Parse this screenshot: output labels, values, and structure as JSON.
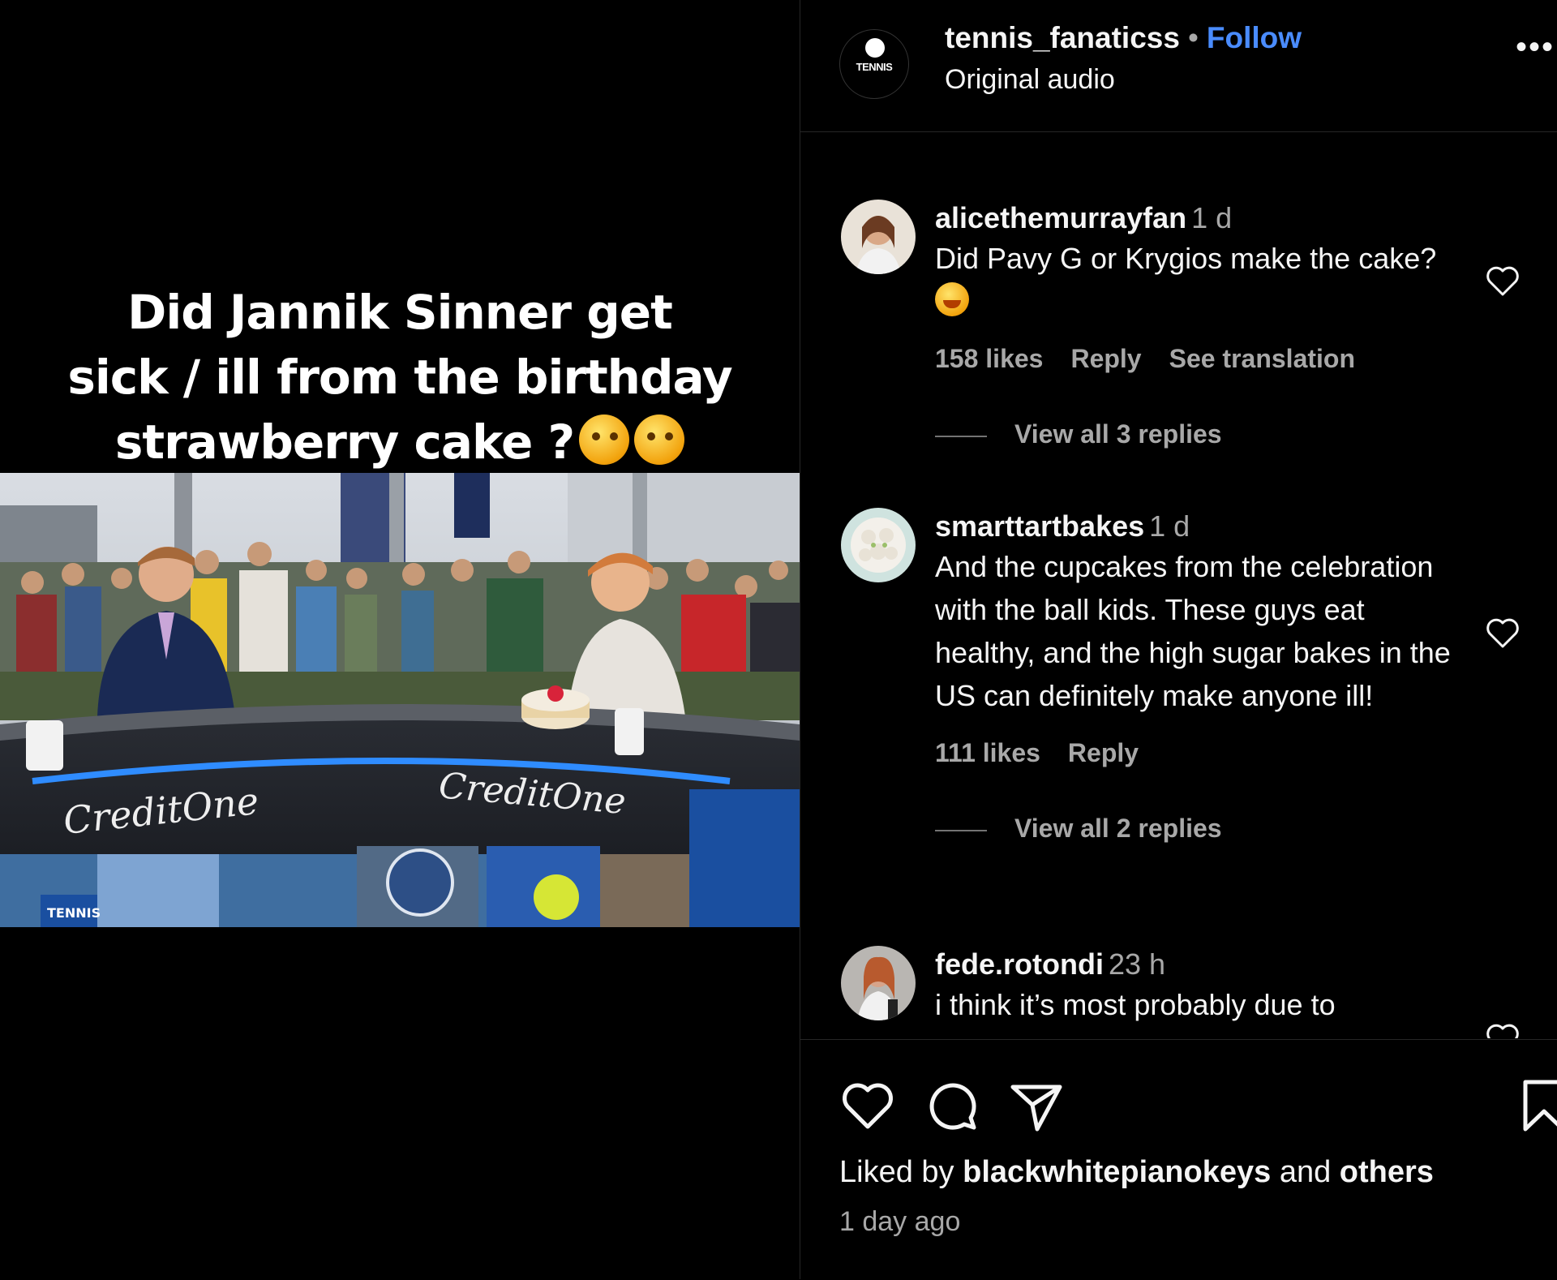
{
  "media": {
    "caption_line1": "Did Jannik Sinner get",
    "caption_line2": "sick / ill from the birthday",
    "caption_line3": "strawberry cake ?",
    "desk_brand_left": "CreditOne",
    "desk_brand_right": "CreditOne",
    "desk_small_brand": "TENNIS"
  },
  "header": {
    "avatar_brand": "TENNIS",
    "username": "tennis_fanaticss",
    "separator": "•",
    "follow_label": "Follow",
    "audio": "Original audio",
    "more": "•••"
  },
  "comments": [
    {
      "username": "alicethemurrayfan",
      "time": "1 d",
      "text": "Did Pavy G or Krygios make the cake?",
      "likes": "158 likes",
      "reply": "Reply",
      "translate": "See translation",
      "view_replies": "View all 3 replies"
    },
    {
      "username": "smarttartbakes",
      "time": "1 d",
      "text": "And the cupcakes from the celebration with the ball kids. These guys eat healthy, and the high sugar bakes in the US can definitely make anyone ill!",
      "likes": "111 likes",
      "reply": "Reply",
      "view_replies": "View all 2 replies"
    },
    {
      "username": "fede.rotondi",
      "time": "23 h",
      "text": "i think it’s most probably due to"
    }
  ],
  "footer": {
    "liked_prefix": "Liked by",
    "liked_user": "blackwhitepianokeys",
    "liked_and": "and",
    "liked_others": "others",
    "posted_ago": "1 day ago"
  }
}
